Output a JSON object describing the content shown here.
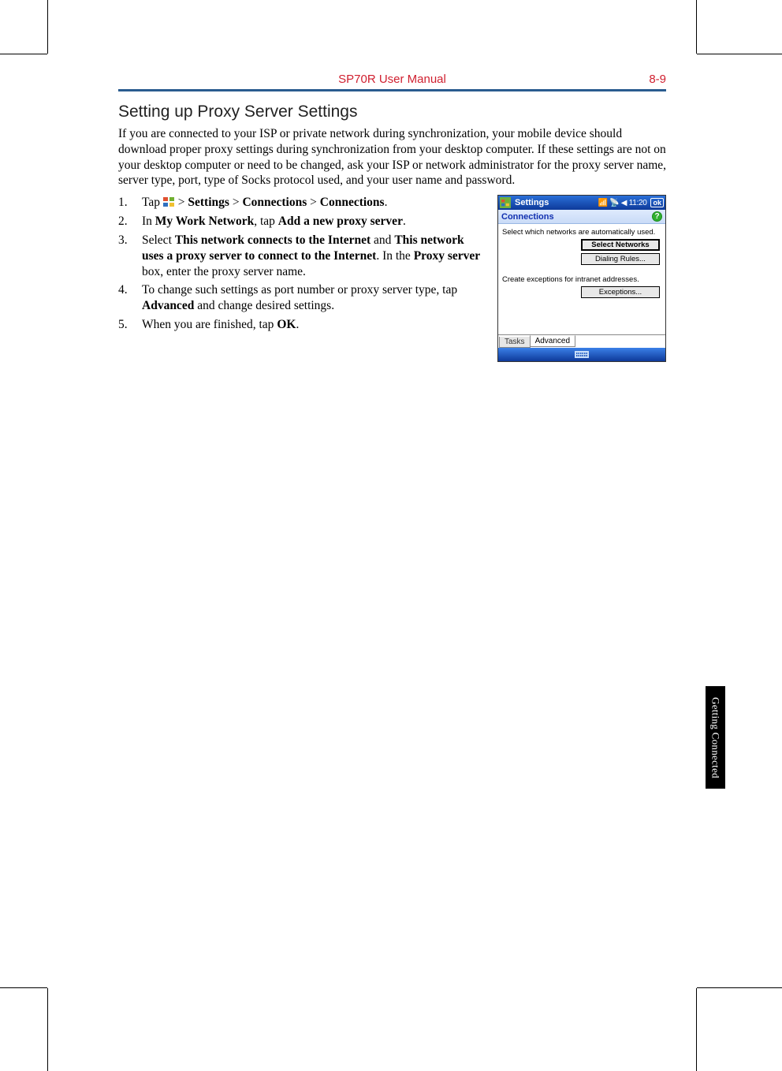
{
  "header": {
    "center": "SP70R User Manual",
    "page_number": "8-9"
  },
  "section": {
    "title": "Setting up Proxy Server Settings",
    "intro": "If you are connected to your ISP or private network during synchronization, your mobile device should download proper proxy settings during synchronization from your desktop computer. If these settings are not on your desktop computer or need to be changed, ask your ISP or network administrator for the proxy server name, server type, port, type of Socks protocol used, and your user name and password."
  },
  "steps": {
    "s1_a": "Tap ",
    "s1_b": " > ",
    "s1_settings": "Settings",
    "s1_c": " > ",
    "s1_connections1": "Connections",
    "s1_d": " > ",
    "s1_connections2": "Connections",
    "s1_e": ".",
    "s2_a": "In ",
    "s2_mwn": "My Work Network",
    "s2_b": ", tap ",
    "s2_add": "Add a new proxy server",
    "s2_c": ".",
    "s3_a": "Select ",
    "s3_b1": "This network connects to the Internet",
    "s3_b": " and ",
    "s3_b2": "This network uses a proxy server to connect to the Internet",
    "s3_c": ". In the ",
    "s3_ps": "Proxy server",
    "s3_d": " box, enter the proxy server name.",
    "s4_a": "To change such settings as port number or proxy server type, tap ",
    "s4_adv": "Advanced",
    "s4_b": " and change desired settings.",
    "s5_a": "When you are finished, tap ",
    "s5_ok": "OK",
    "s5_b": "."
  },
  "device": {
    "titlebar": {
      "title": "Settings",
      "time": "11:20",
      "ok": "ok"
    },
    "subbar": {
      "link": "Connections",
      "help": "?"
    },
    "body": {
      "line1": "Select which networks are automatically used.",
      "btn_select_networks": "Select Networks",
      "btn_dialing_rules": "Dialing Rules...",
      "line2": "Create exceptions for intranet addresses.",
      "btn_exceptions": "Exceptions..."
    },
    "tabs": {
      "tasks": "Tasks",
      "advanced": "Advanced"
    }
  },
  "side_tab": "Getting Connected"
}
